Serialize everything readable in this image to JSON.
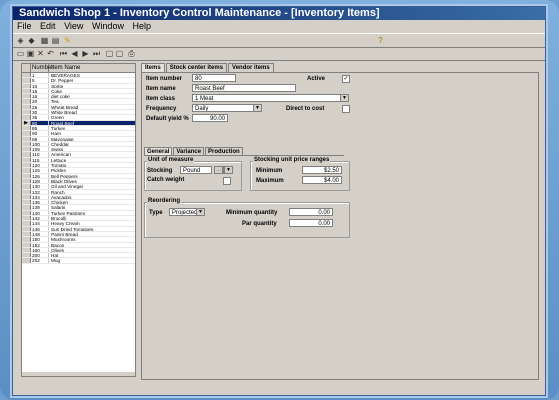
{
  "window": {
    "title": "Sandwich Shop 1 - Inventory Control Maintenance - [Inventory Items]"
  },
  "menu": [
    "File",
    "Edit",
    "View",
    "Window",
    "Help"
  ],
  "grid": {
    "headers": [
      "Number",
      "Item Name"
    ],
    "rows": [
      [
        "1",
        "BEVERAGES"
      ],
      [
        "5",
        "Dr. Pepper"
      ],
      [
        "10",
        "Sprite"
      ],
      [
        "15",
        "Coke"
      ],
      [
        "16",
        "diet coke"
      ],
      [
        "20",
        "Tea"
      ],
      [
        "25",
        "Wheat Bread"
      ],
      [
        "30",
        "White Bread"
      ],
      [
        "35",
        "Green"
      ],
      [
        "80",
        "Roast Beef"
      ],
      [
        "85",
        "Turkey"
      ],
      [
        "90",
        "Ham"
      ],
      [
        "95",
        "Mayonaise"
      ],
      [
        "100",
        "Cheddar"
      ],
      [
        "105",
        "Swiss"
      ],
      [
        "110",
        "American"
      ],
      [
        "115",
        "Lettuce"
      ],
      [
        "120",
        "Tomato"
      ],
      [
        "125",
        "Pickles"
      ],
      [
        "126",
        "Bell Peppers"
      ],
      [
        "128",
        "Black Olives"
      ],
      [
        "130",
        "Oil and Vinegar"
      ],
      [
        "132",
        "Ranch"
      ],
      [
        "134",
        "Avacados"
      ],
      [
        "136",
        "Chicken"
      ],
      [
        "138",
        "Salami"
      ],
      [
        "140",
        "Turkey Pastrami"
      ],
      [
        "142",
        "Brocolli"
      ],
      [
        "144",
        "Heavy Cream"
      ],
      [
        "146",
        "Sun Dried Tomatoes"
      ],
      [
        "148",
        "Panini Bread"
      ],
      [
        "150",
        "Mushrooms"
      ],
      [
        "152",
        "Bacon"
      ],
      [
        "160",
        "Olives"
      ],
      [
        "200",
        "Hat"
      ],
      [
        "202",
        "Mug"
      ]
    ],
    "selected_index": 9
  },
  "tabs": [
    "Items",
    "Stock center items",
    "Vendor items"
  ],
  "form": {
    "item_number_label": "Item number",
    "item_number": "80",
    "active_label": "Active",
    "active_mark": "✓",
    "item_name_label": "Item name",
    "item_name": "Roast Beef",
    "item_class_label": "Item class",
    "item_class": "1 Meat",
    "frequency_label": "Frequency",
    "frequency": "Daily",
    "direct_cost_label": "Direct to cost",
    "default_yield_label": "Default yield %",
    "default_yield": "90.00"
  },
  "subtabs": [
    "General",
    "Variance",
    "Production"
  ],
  "general": {
    "uom_title": "Unit of measure",
    "stocking_label": "Stocking",
    "stocking": "Pound",
    "catch_weight_label": "Catch weight",
    "price_title": "Stocking unit price ranges",
    "minimum_label": "Minimum",
    "minimum": "$2.50",
    "maximum_label": "Maximum",
    "maximum": "$4.00",
    "reorder_title": "Reordering",
    "type_label": "Type",
    "type": "Projected",
    "min_qty_label": "Minimum quantity",
    "min_qty": "0.00",
    "par_qty_label": "Par quantity",
    "par_qty": "0.00"
  }
}
